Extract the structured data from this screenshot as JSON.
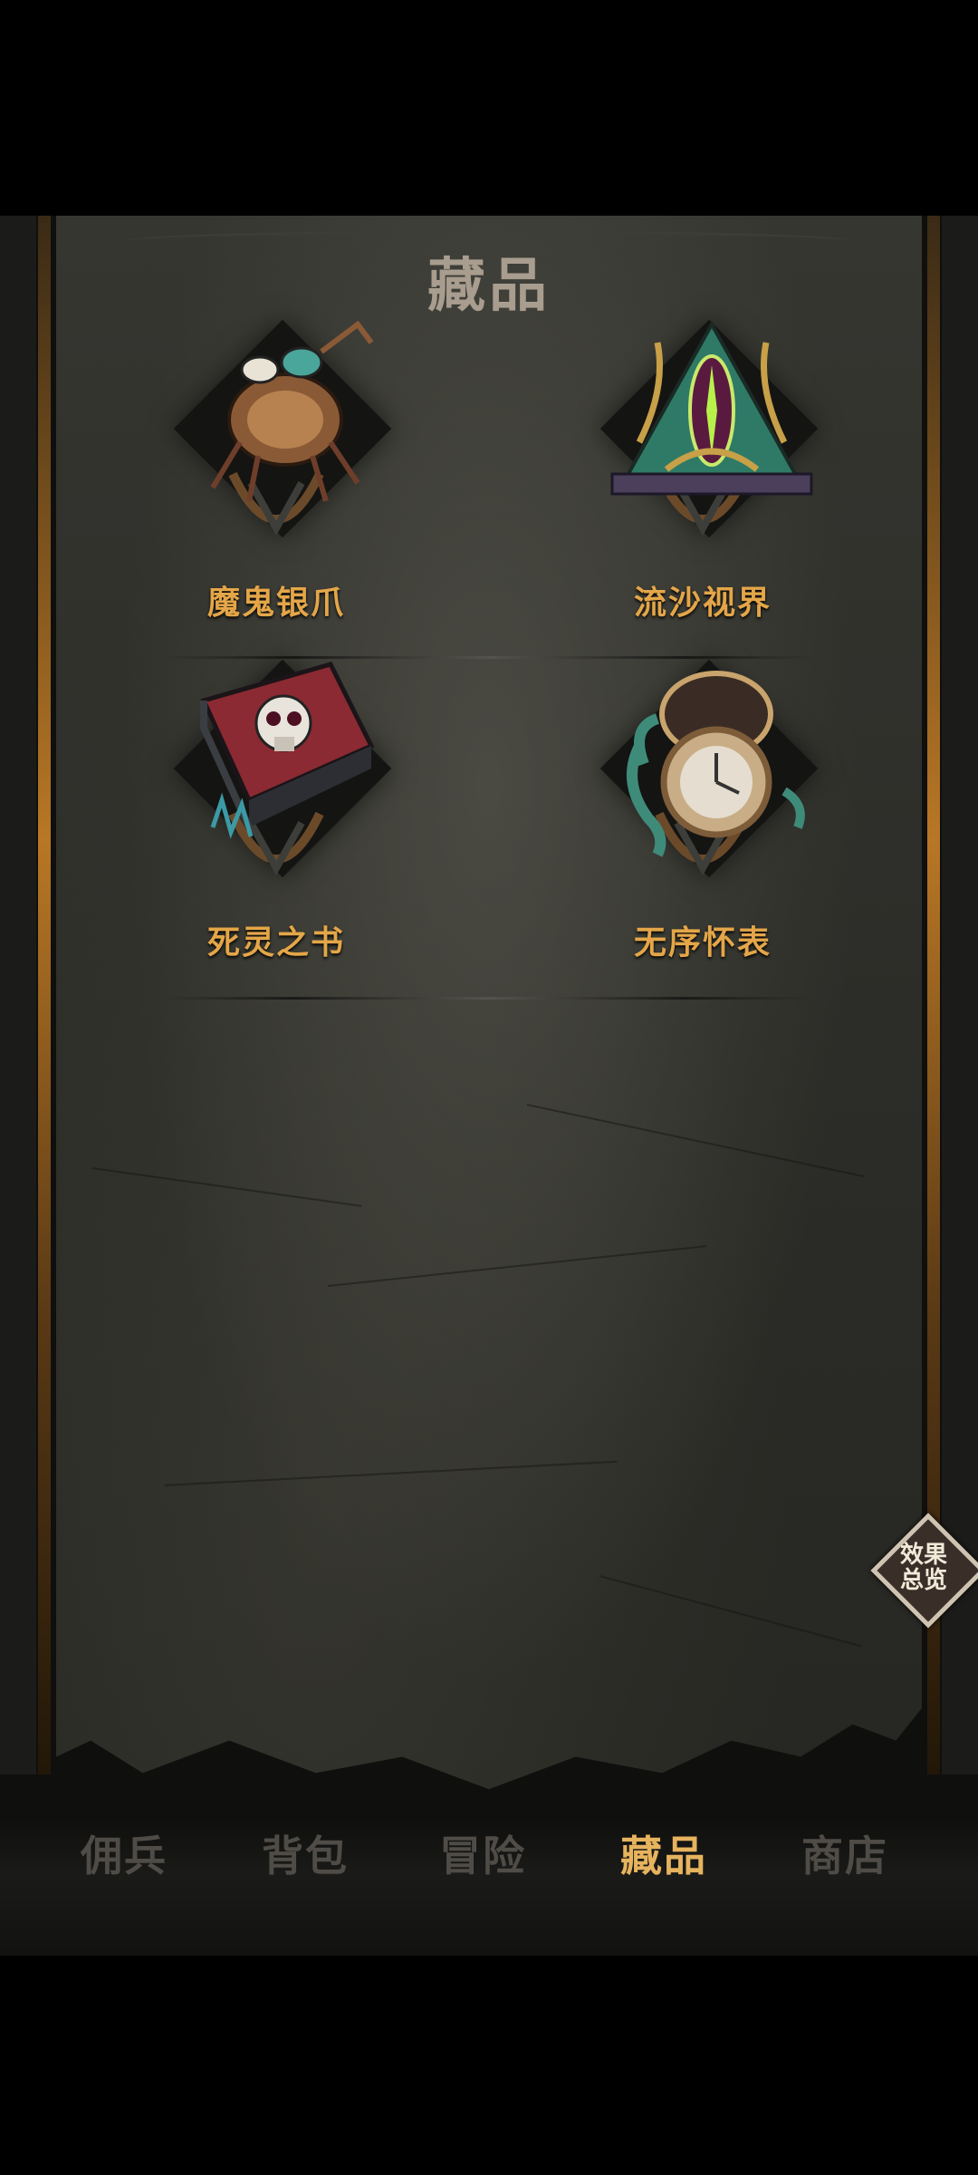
{
  "page": {
    "title": "藏品"
  },
  "collection": {
    "items": [
      {
        "name": "魔鬼银爪",
        "icon": "beetle-claw-icon"
      },
      {
        "name": "流沙视界",
        "icon": "tentacle-eye-pyramid-icon"
      },
      {
        "name": "死灵之书",
        "icon": "skull-book-icon"
      },
      {
        "name": "无序怀表",
        "icon": "tentacle-pocket-watch-icon"
      }
    ]
  },
  "effects_button": {
    "line1": "效果",
    "line2": "总览"
  },
  "nav": {
    "tabs": [
      {
        "label": "佣兵",
        "active": false
      },
      {
        "label": "背包",
        "active": false
      },
      {
        "label": "冒险",
        "active": false
      },
      {
        "label": "藏品",
        "active": true
      },
      {
        "label": "商店",
        "active": false
      }
    ]
  },
  "colors": {
    "accent": "#e6b35e",
    "item_name": "#e4a648",
    "inactive_tab": "#4f4c47"
  }
}
